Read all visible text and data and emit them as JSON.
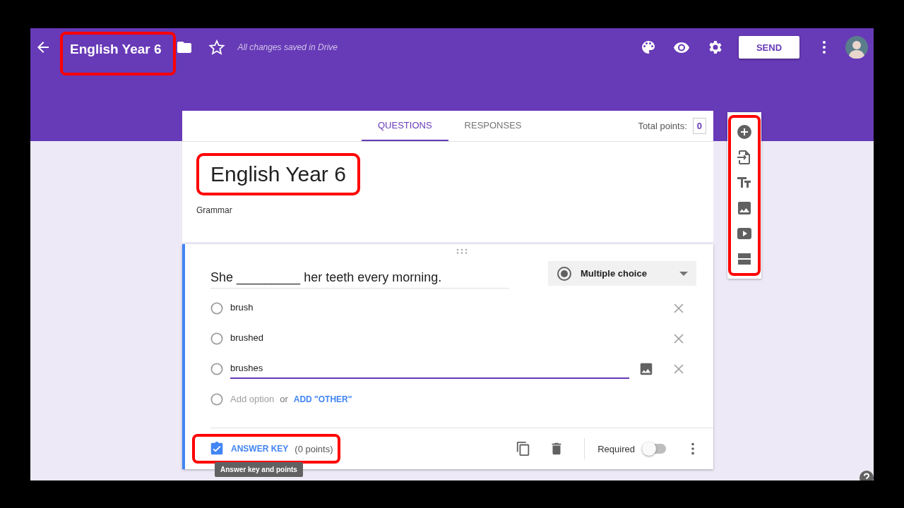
{
  "header": {
    "title": "English Year 6",
    "title_highlighted": true,
    "save_status": "All changes saved in Drive",
    "send_label": "SEND"
  },
  "tabs": [
    {
      "label": "QUESTIONS",
      "selected": true
    },
    {
      "label": "RESPONSES",
      "selected": false
    }
  ],
  "total_points": {
    "label": "Total points:",
    "value": "0"
  },
  "form": {
    "title": "English Year 6",
    "title_highlighted": true,
    "description": "Grammar"
  },
  "question": {
    "text": "She _________ her teeth every morning.",
    "type": "Multiple choice",
    "options": [
      {
        "label": "brush",
        "focused": false,
        "selected": false
      },
      {
        "label": "brushed",
        "focused": false,
        "selected": false
      },
      {
        "label": "brushes",
        "focused": true,
        "selected": false
      }
    ],
    "add_option": "Add option",
    "add_option_selected": false,
    "or": "or",
    "add_other": "ADD \"OTHER\"",
    "answer_key": {
      "label": "ANSWER KEY",
      "points": "(0 points)",
      "highlighted": true
    },
    "tooltip": "Answer key and points",
    "required": {
      "label": "Required",
      "on": false
    }
  },
  "toolbar": {
    "highlighted": true
  }
}
